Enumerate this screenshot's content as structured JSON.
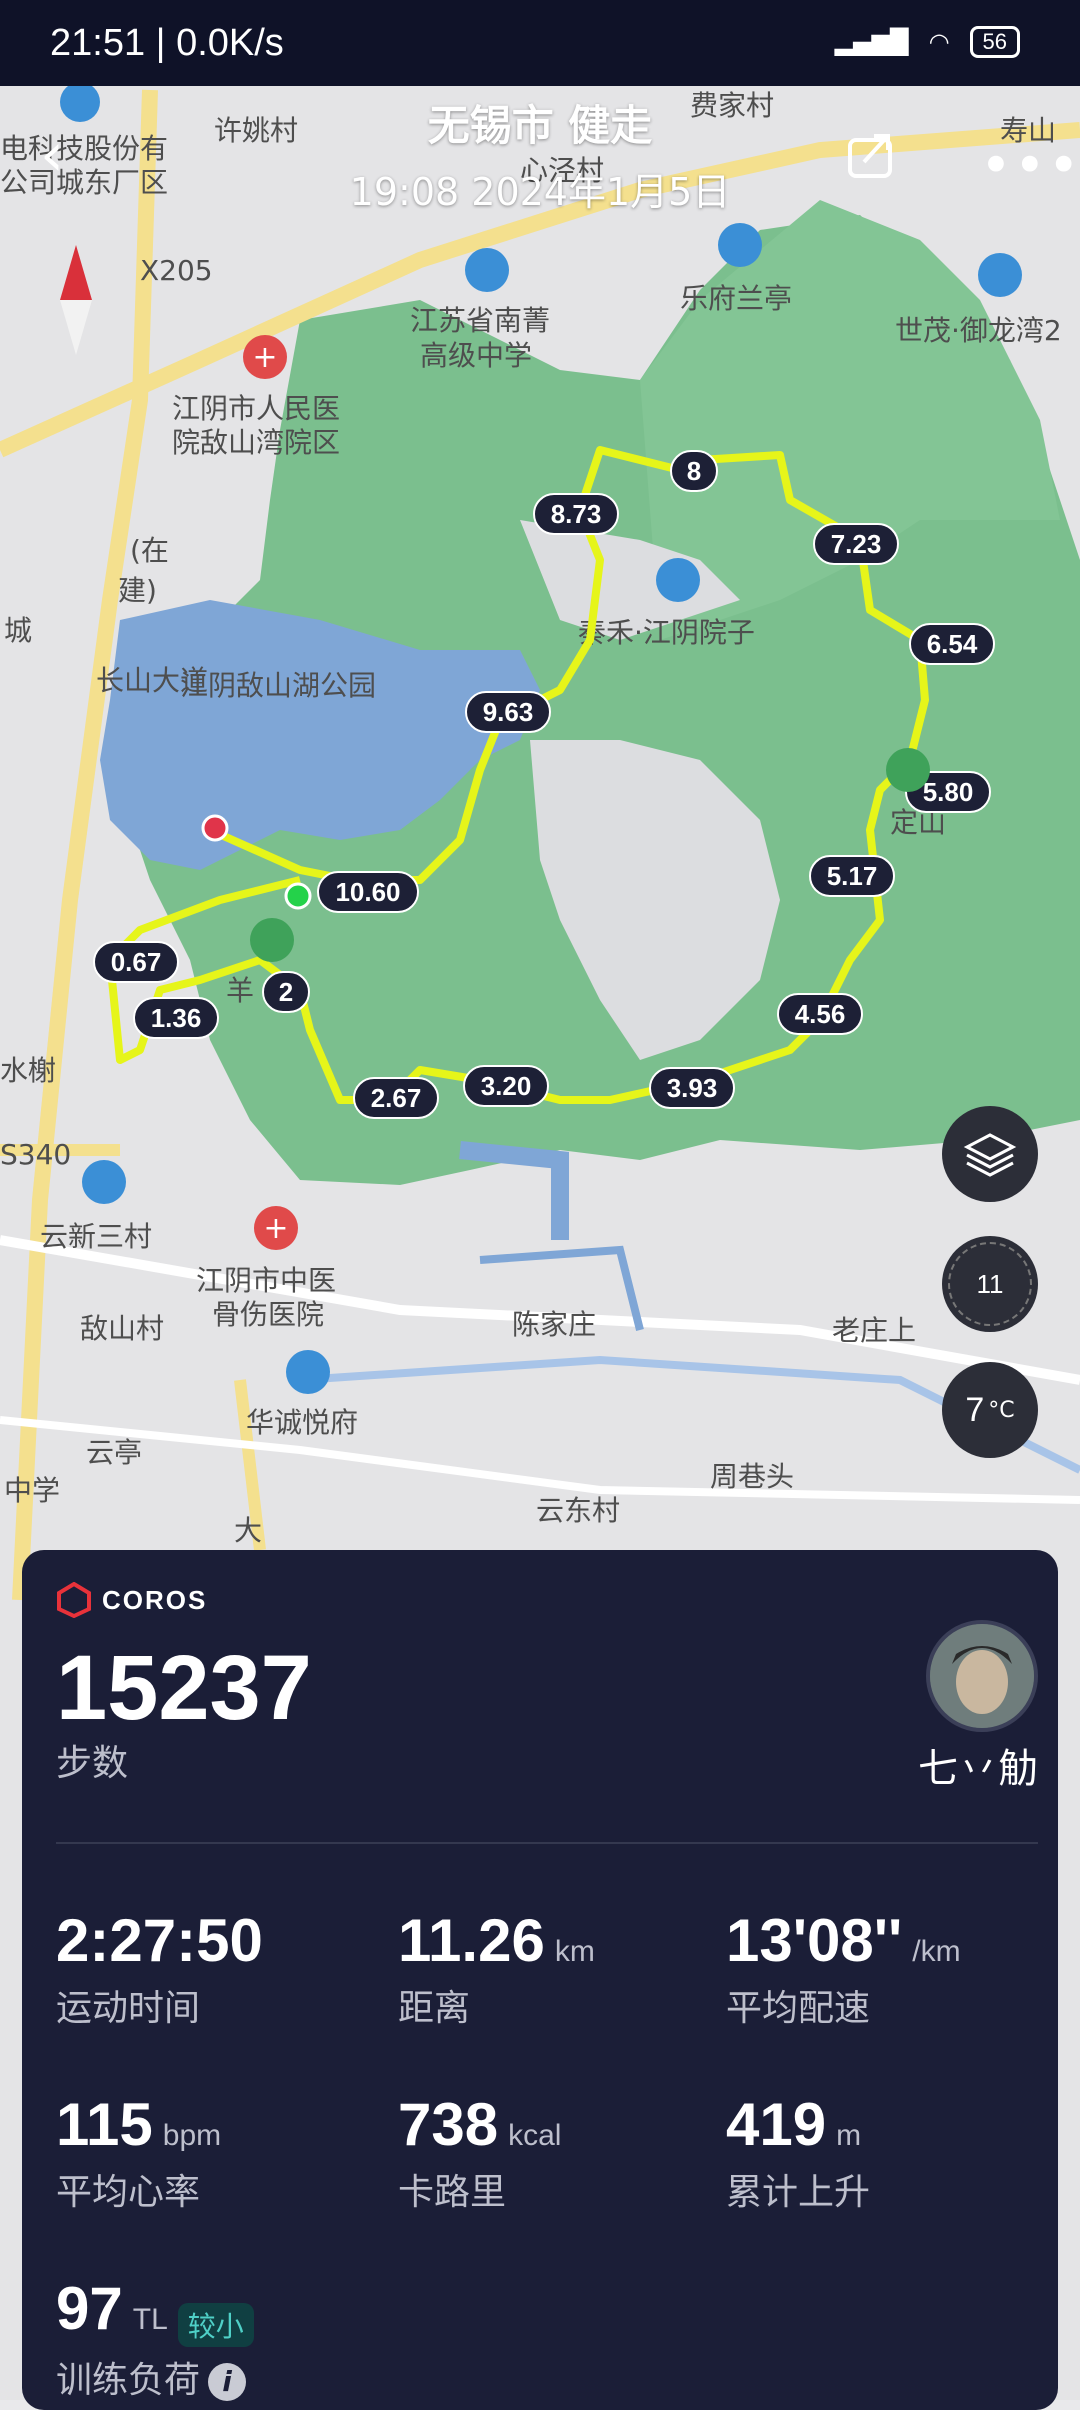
{
  "status": {
    "time": "21:51 | 0.0K/s",
    "battery": "56"
  },
  "header": {
    "title": "无锡市 健走",
    "datetime": "19:08 2024年1月5日"
  },
  "map": {
    "labels": [
      "电科技股份有",
      "公司城东厂区",
      "许姚村",
      "费家村",
      "心泾村",
      "寿山",
      "X205",
      "江苏省南菁",
      "高级中学",
      "乐府兰亭",
      "世茂·御龙湾2",
      "江阴市人民医",
      "院敌山湾院区",
      "(在",
      "建)",
      "长山大道",
      "城",
      "秦禾·江阴院子",
      "江阴敌山湖公园",
      "定山",
      "羊",
      "水榭",
      "S340",
      "云新三村",
      "江阴市中医",
      "骨伤医院",
      "陈家庄",
      "老庄上",
      "敌山村",
      "华诚悦府",
      "云亭",
      "中学",
      "周巷头",
      "云东村",
      "大"
    ],
    "km_markers": [
      "8",
      "8.73",
      "7.23",
      "6.54",
      "9.63",
      "5.80",
      "5.17",
      "10.60",
      "0.67",
      "2",
      "1.36",
      "4.56",
      "2.67",
      "3.20",
      "3.93"
    ]
  },
  "controls": {
    "compass_value": "11",
    "weather": "7",
    "weather_unit": "°C"
  },
  "panel": {
    "brand": "COROS",
    "steps": "15237",
    "steps_label": "步数",
    "username": "七丷觔",
    "stats": [
      {
        "value": "2:27:50",
        "unit": "",
        "label": "运动时间"
      },
      {
        "value": "11.26",
        "unit": "km",
        "label": "距离"
      },
      {
        "value": "13'08''",
        "unit": "/km",
        "label": "平均配速"
      },
      {
        "value": "115",
        "unit": "bpm",
        "label": "平均心率"
      },
      {
        "value": "738",
        "unit": "kcal",
        "label": "卡路里"
      },
      {
        "value": "419",
        "unit": "m",
        "label": "累计上升"
      },
      {
        "value": "97",
        "unit": "TL",
        "label": "训练负荷",
        "badge": "较小"
      }
    ]
  },
  "colors": {
    "route": "#e6f51a",
    "park": "#79c08e",
    "water": "#7fa6d6",
    "panel": "#1b1e37"
  }
}
